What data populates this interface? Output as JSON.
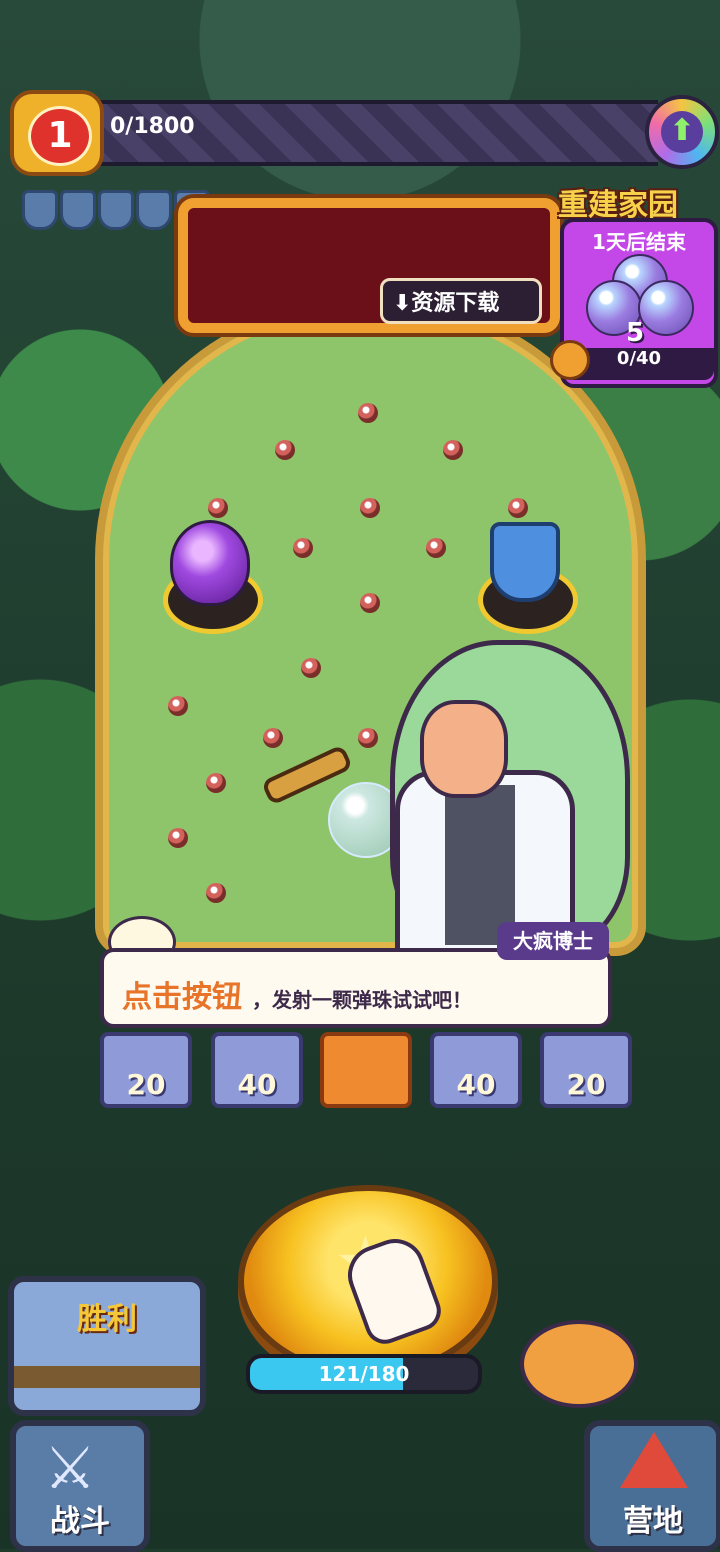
{
  "top_bar": {
    "level": "1",
    "progress_text": "0/1800",
    "up_icon_glyph": "⬆"
  },
  "banner": {
    "download_label": "⬇资源下载"
  },
  "event": {
    "title": "重建家园",
    "timer": "1天后结束",
    "count": "5",
    "progress": "0/40"
  },
  "dialog": {
    "speaker": "大疯博士",
    "highlight": "点击按钮",
    "rest": "，发射一颗弹珠试试吧！"
  },
  "slots": [
    "20",
    "40",
    "",
    "40",
    "20"
  ],
  "launch": {
    "star_glyph": "★",
    "power_text": "121/180",
    "power_fraction": 0.672
  },
  "bottom": {
    "victory_label": "胜利",
    "battle_label": "战斗",
    "camp_label": "营地",
    "battle_glyph": "⚔"
  }
}
